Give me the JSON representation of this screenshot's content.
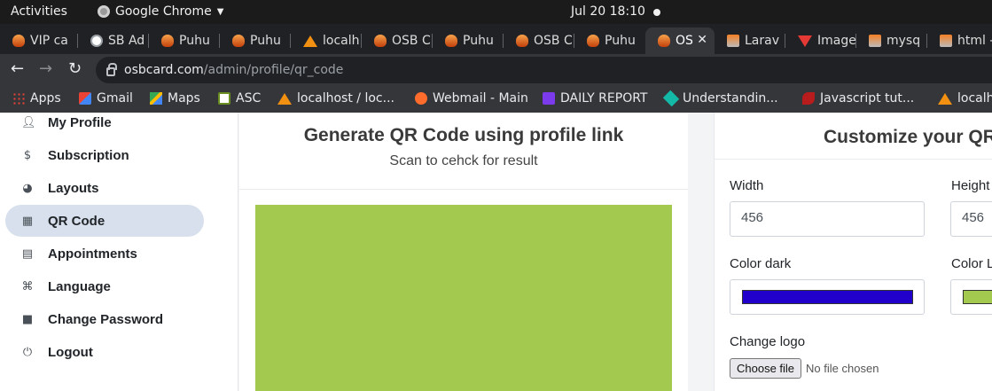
{
  "os_bar": {
    "activities": "Activities",
    "app_name": "Google Chrome",
    "clock": "Jul 20  18:10"
  },
  "tabs": [
    {
      "label": "VIP ca",
      "icon": "flame-icon"
    },
    {
      "label": "SB Ad",
      "icon": "globe-icon"
    },
    {
      "label": "Puhu",
      "icon": "flame-icon"
    },
    {
      "label": "Puhu",
      "icon": "flame-icon"
    },
    {
      "label": "localh",
      "icon": "phpmyadmin-icon"
    },
    {
      "label": "OSB C",
      "icon": "flame-icon"
    },
    {
      "label": "Puhu",
      "icon": "flame-icon"
    },
    {
      "label": "OSB C",
      "icon": "flame-icon"
    },
    {
      "label": "Puhu",
      "icon": "flame-icon"
    },
    {
      "label": "OS",
      "icon": "flame-icon",
      "active": true,
      "close": "✕"
    },
    {
      "label": "Larav",
      "icon": "stackoverflow-icon"
    },
    {
      "label": "Image",
      "icon": "vuetify-icon"
    },
    {
      "label": "mysq",
      "icon": "stackoverflow-icon"
    },
    {
      "label": "html -",
      "icon": "stackoverflow-icon"
    }
  ],
  "omnibox": {
    "host": "osbcard.com",
    "path": "/admin/profile/qr_code"
  },
  "bookmarks": [
    {
      "label": "Apps",
      "icon": "apps-icon"
    },
    {
      "label": "Gmail",
      "icon": "gmail-icon"
    },
    {
      "label": "Maps",
      "icon": "maps-icon"
    },
    {
      "label": "ASC",
      "icon": "asc-icon"
    },
    {
      "label": "localhost / loc...",
      "icon": "phpmyadmin-icon"
    },
    {
      "label": "Webmail - Main",
      "icon": "cpanel-icon"
    },
    {
      "label": "DAILY REPORT",
      "icon": "report-icon"
    },
    {
      "label": "Understandin...",
      "icon": "understanding-icon"
    },
    {
      "label": "Javascript tut...",
      "icon": "javascript-icon"
    },
    {
      "label": "localh",
      "icon": "phpmyadmin-icon"
    }
  ],
  "sidebar": {
    "items": [
      {
        "label": "My Profile",
        "icon": "user-icon"
      },
      {
        "label": "Subscription",
        "icon": "dollar-icon"
      },
      {
        "label": "Layouts",
        "icon": "palette-icon"
      },
      {
        "label": "QR Code",
        "icon": "qrcode-icon",
        "active": true
      },
      {
        "label": "Appointments",
        "icon": "calendar-icon"
      },
      {
        "label": "Language",
        "icon": "language-icon"
      },
      {
        "label": "Change Password",
        "icon": "lock-icon"
      },
      {
        "label": "Logout",
        "icon": "power-icon"
      }
    ]
  },
  "qr_panel": {
    "title": "Generate QR Code using profile link",
    "subtitle": "Scan to cehck for result",
    "qr_light_color": "#a3c94f"
  },
  "customize_panel": {
    "title": "Customize your QR",
    "width_label": "Width",
    "width_value": "456",
    "height_label": "Height",
    "height_value": "456",
    "color_dark_label": "Color dark",
    "color_dark_value": "#2200cc",
    "color_light_label": "Color Light",
    "color_light_value": "#a3c94f",
    "logo_label": "Change logo",
    "file_button": "Choose file",
    "file_status": "No file chosen"
  }
}
